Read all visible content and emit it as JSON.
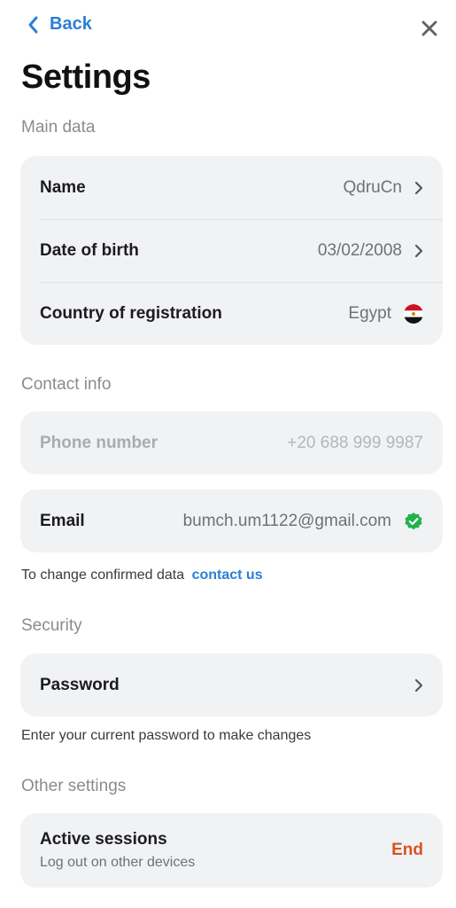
{
  "header": {
    "back_label": "Back",
    "title": "Settings"
  },
  "main_data": {
    "section_label": "Main data",
    "name": {
      "label": "Name",
      "value": "QdruCn"
    },
    "birth": {
      "label": "Date of birth",
      "value": "03/02/2008"
    },
    "country": {
      "label": "Country of registration",
      "value": "Egypt"
    }
  },
  "contact": {
    "section_label": "Contact info",
    "phone": {
      "label": "Phone number",
      "value": "+20 688 999 9987"
    },
    "email": {
      "label": "Email",
      "value": "bumch.um1122@gmail.com"
    },
    "note": "To change confirmed data",
    "link": "contact us"
  },
  "security": {
    "section_label": "Security",
    "password_label": "Password",
    "note": "Enter your current password to make changes"
  },
  "other": {
    "section_label": "Other settings",
    "sessions_title": "Active sessions",
    "sessions_sub": "Log out on other devices",
    "end_label": "End"
  },
  "colors": {
    "accent": "#2a7fd6",
    "danger": "#d9531e",
    "verified": "#22b24c",
    "card_bg": "#f1f2f4"
  }
}
